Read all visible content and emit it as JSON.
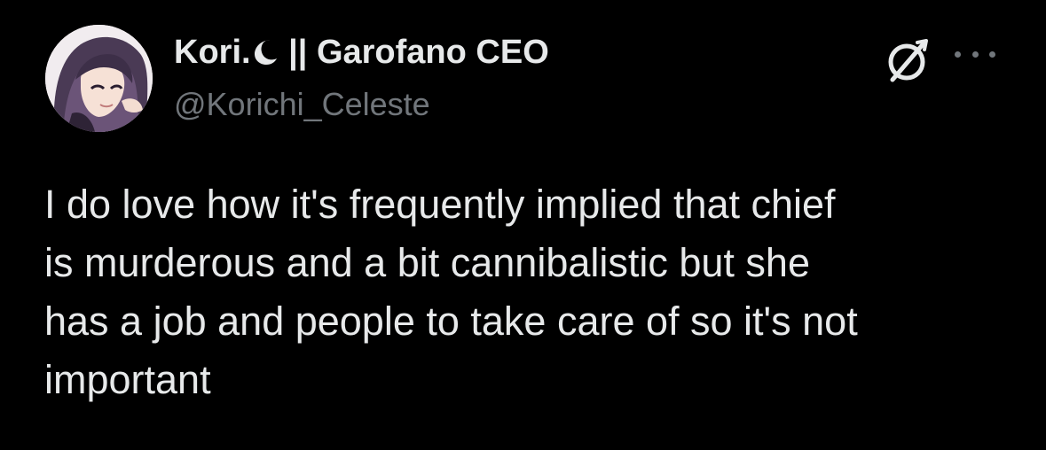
{
  "author": {
    "display_name": "Kori.",
    "display_name_rest": " || Garofano CEO",
    "handle": "@Korichi_Celeste",
    "avatar_icon": "anime-character-avatar"
  },
  "header": {
    "x_logo_icon": "x-logo-icon",
    "more_icon": "more-horizontal-icon"
  },
  "tweet": {
    "text": "I do love how it's frequently implied that chief\nis murderous and a bit cannibalistic but she\nhas a job and people to take care of so it's not\nimportant"
  },
  "colors": {
    "background": "#000000",
    "primary_text": "#e7e9ea",
    "secondary_text": "#71767b"
  }
}
